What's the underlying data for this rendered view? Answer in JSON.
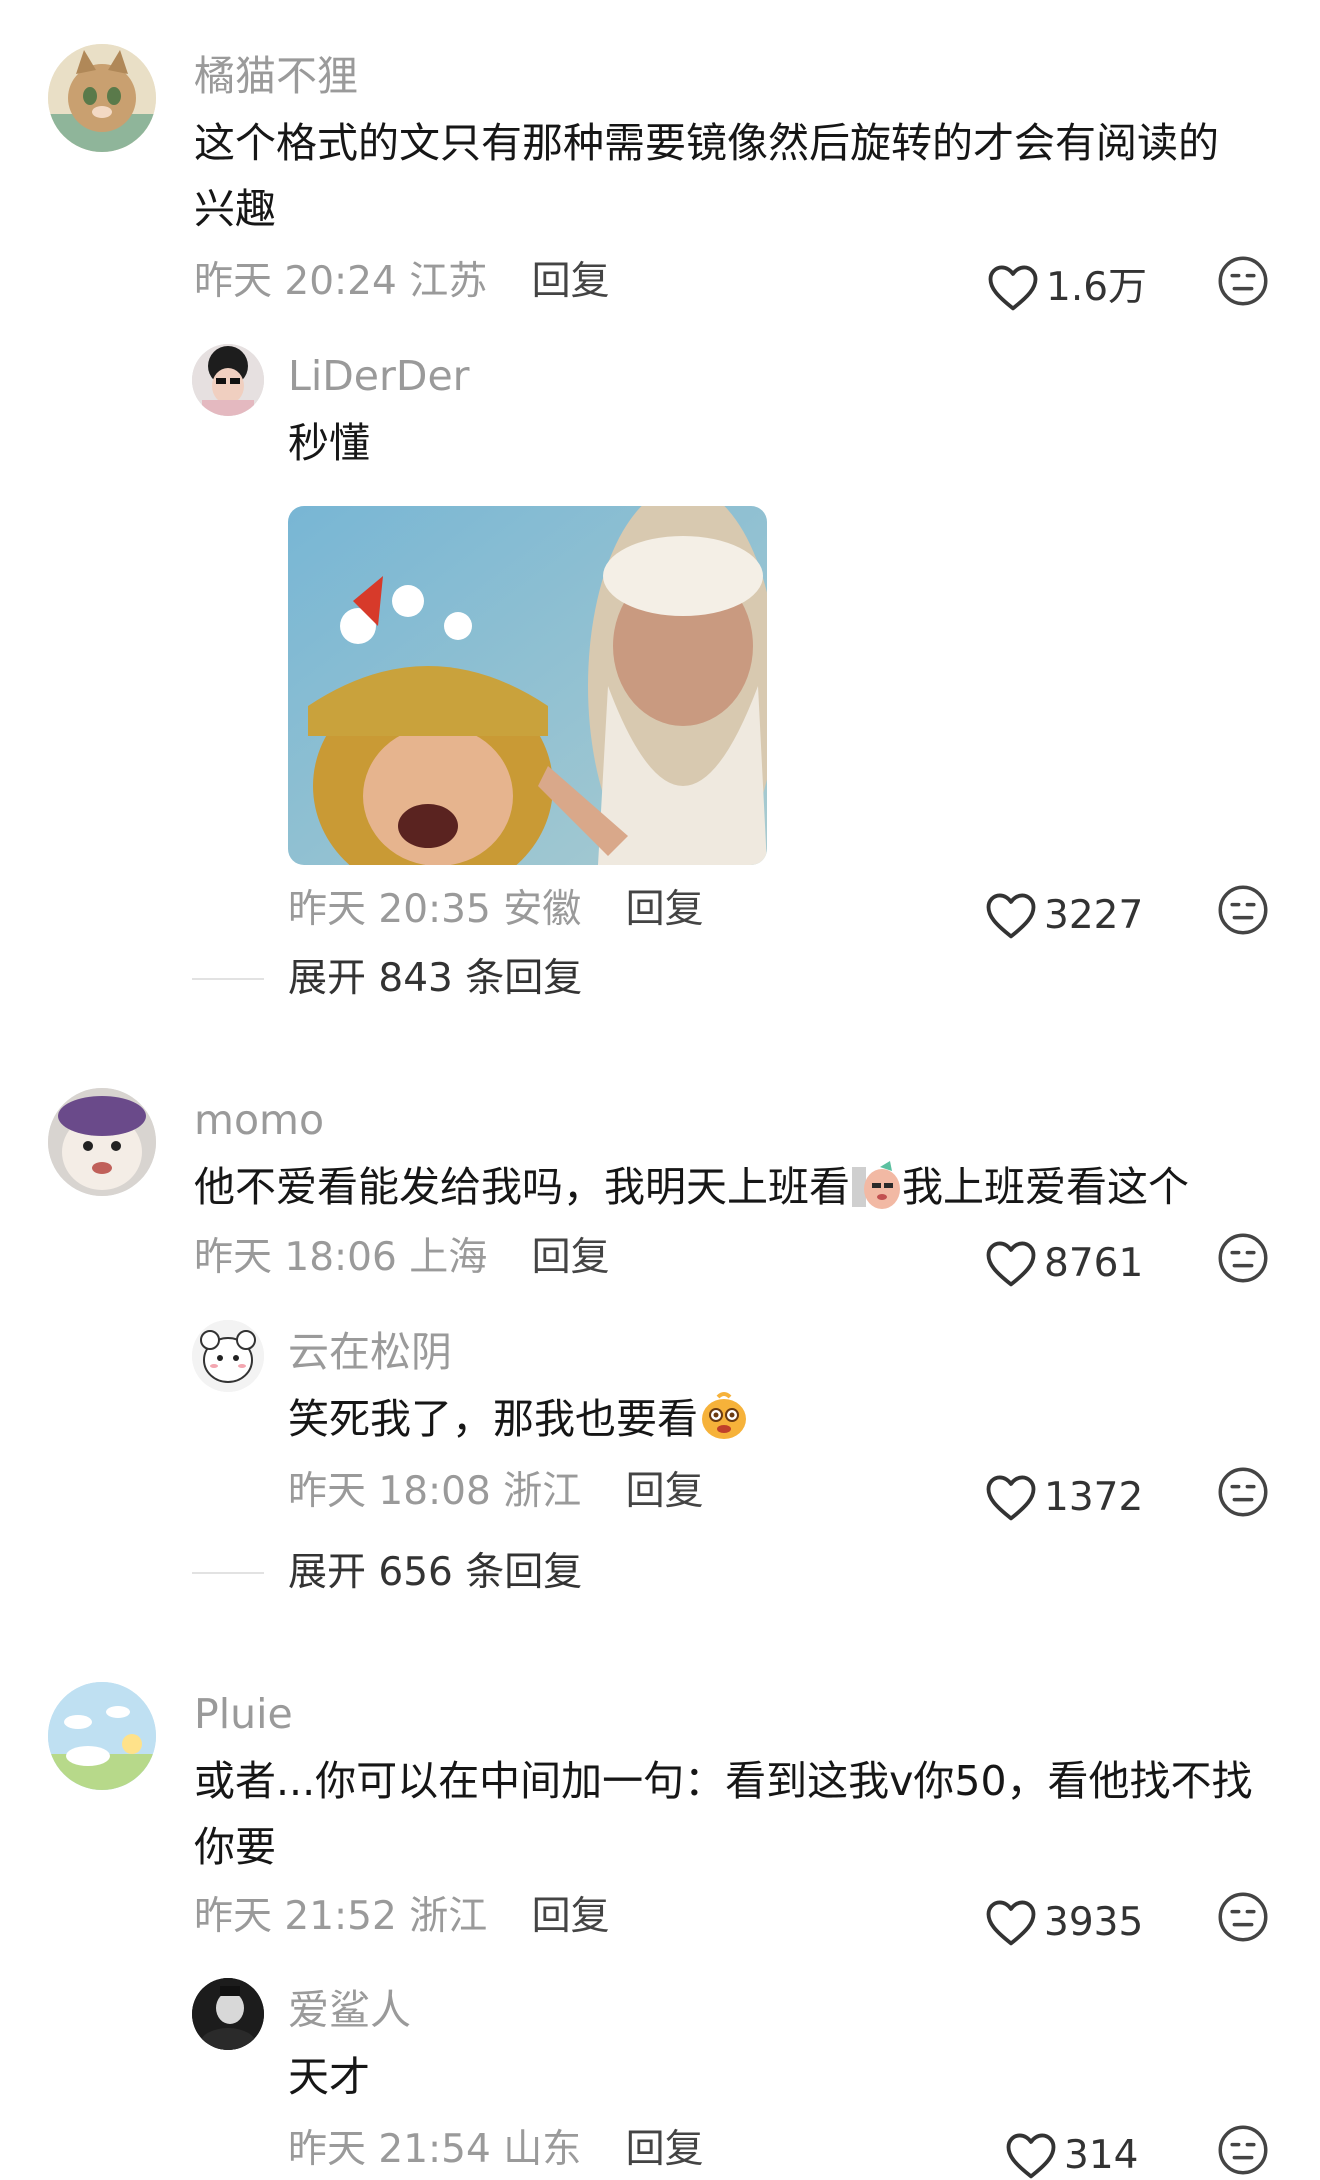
{
  "comments": [
    {
      "user": "橘猫不狸",
      "text": "这个格式的文只有那种需要镜像然后旋转的才会有阅读的兴趣",
      "time": "昨天 20:24",
      "location": "江苏",
      "reply_label": "回复",
      "likes": "1.6万",
      "replies": [
        {
          "user": "LiDerDer",
          "text": "秒懂",
          "time": "昨天 20:35",
          "location": "安徽",
          "reply_label": "回复",
          "likes": "3227"
        }
      ],
      "expand_label": "展开 843 条回复"
    },
    {
      "user": "momo",
      "text_a": "他不爱看能发给我吗，我明天上班看",
      "text_b": "我上班爱看这个",
      "time": "昨天 18:06",
      "location": "上海",
      "reply_label": "回复",
      "likes": "8761",
      "replies": [
        {
          "user": "云在松阴",
          "text": "笑死我了，那我也要看",
          "time": "昨天 18:08",
          "location": "浙江",
          "reply_label": "回复",
          "likes": "1372"
        }
      ],
      "expand_label": "展开 656 条回复"
    },
    {
      "user": "Pluie",
      "text": "或者...你可以在中间加一句：看到这我v你50，看他找不找你要",
      "time": "昨天 21:52",
      "location": "浙江",
      "reply_label": "回复",
      "likes": "3935",
      "replies": [
        {
          "user": "爱鲨人",
          "text": "天才",
          "time": "昨天 21:54",
          "location": "山东",
          "reply_label": "回复",
          "likes": "314"
        }
      ]
    }
  ],
  "icons": {
    "like": "heart-outline-icon",
    "dislike": "neutral-face-icon"
  },
  "colors": {
    "text": "#161616",
    "meta": "#9a9a9a",
    "background": "#ffffff"
  }
}
